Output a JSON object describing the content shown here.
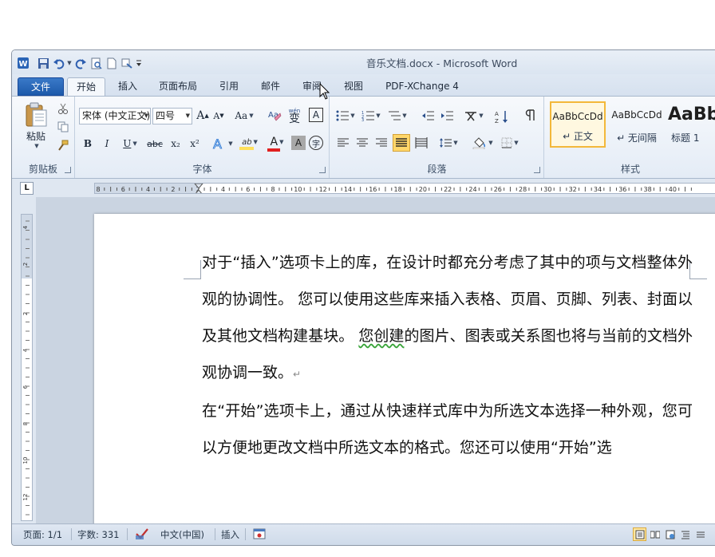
{
  "window": {
    "title": "音乐文档.docx - Microsoft Word"
  },
  "tabs": [
    {
      "label": "文件",
      "kind": "file"
    },
    {
      "label": "开始",
      "kind": "active"
    },
    {
      "label": "插入"
    },
    {
      "label": "页面布局"
    },
    {
      "label": "引用"
    },
    {
      "label": "邮件"
    },
    {
      "label": "审阅"
    },
    {
      "label": "视图"
    },
    {
      "label": "PDF-XChange 4"
    }
  ],
  "ribbon": {
    "clipboard": {
      "label": "剪贴板",
      "paste": "粘贴"
    },
    "font": {
      "label": "字体",
      "font_name": "宋体 (中文正文)",
      "font_size": "四号",
      "grow": "A",
      "shrink": "A",
      "case": "Aa",
      "bold": "B",
      "italic": "I",
      "underline": "U",
      "strike": "abc",
      "sub": "x₂",
      "sup": "x²",
      "highlight": "ab",
      "font_color": "A",
      "char_shade": "A",
      "phonetic": "wén",
      "phonetic_char": "变",
      "border_char": "A",
      "enclose": "字"
    },
    "paragraph": {
      "label": "段落"
    },
    "styles": {
      "label": "样式",
      "items": [
        {
          "sample": "AaBbCcDd",
          "name": "↵ 正文"
        },
        {
          "sample": "AaBbCcDd",
          "name": "↵ 无间隔"
        },
        {
          "sample": "AaBb",
          "name": "标题 1"
        }
      ]
    }
  },
  "ruler": {
    "h_labels": [
      "8",
      "6",
      "4",
      "2",
      "2",
      "4",
      "6",
      "8",
      "10",
      "12",
      "14",
      "16",
      "18",
      "20",
      "22",
      "24",
      "26",
      "28",
      "30",
      "32",
      "34",
      "36",
      "38",
      "40"
    ],
    "v_labels": [
      "4",
      "2",
      "2",
      "4",
      "6",
      "8",
      "10",
      "12"
    ],
    "corner": "L"
  },
  "document": {
    "paragraphs": [
      {
        "pre": "对于“插入”选项卡上的库，在设计时都充分考虑了其中的项与文档整体外观的协调性。 您可以使用这些库来插入表格、页眉、页脚、列表、封面以及其他文档构建基块。 ",
        "flag": "您创建",
        "post": "的图片、图表或关系图也将与当前的文档外观协调一致。",
        "mark": "↵"
      },
      {
        "pre": "在“开始”选项卡上，通过从快速样式库中为所选文本选择一种外观，您可以方便地更改文档中所选文本的格式。您还可以使用“开始”选",
        "flag": "",
        "post": "",
        "mark": ""
      }
    ]
  },
  "status": {
    "page": "页面: 1/1",
    "words": "字数: 331",
    "language": "中文(中国)",
    "mode": "插入"
  },
  "colors": {
    "file_tab": "#1d5aaa",
    "highlight": "#ffe05a",
    "font_color": "#e02020",
    "selected_style": "#f3b83a"
  }
}
